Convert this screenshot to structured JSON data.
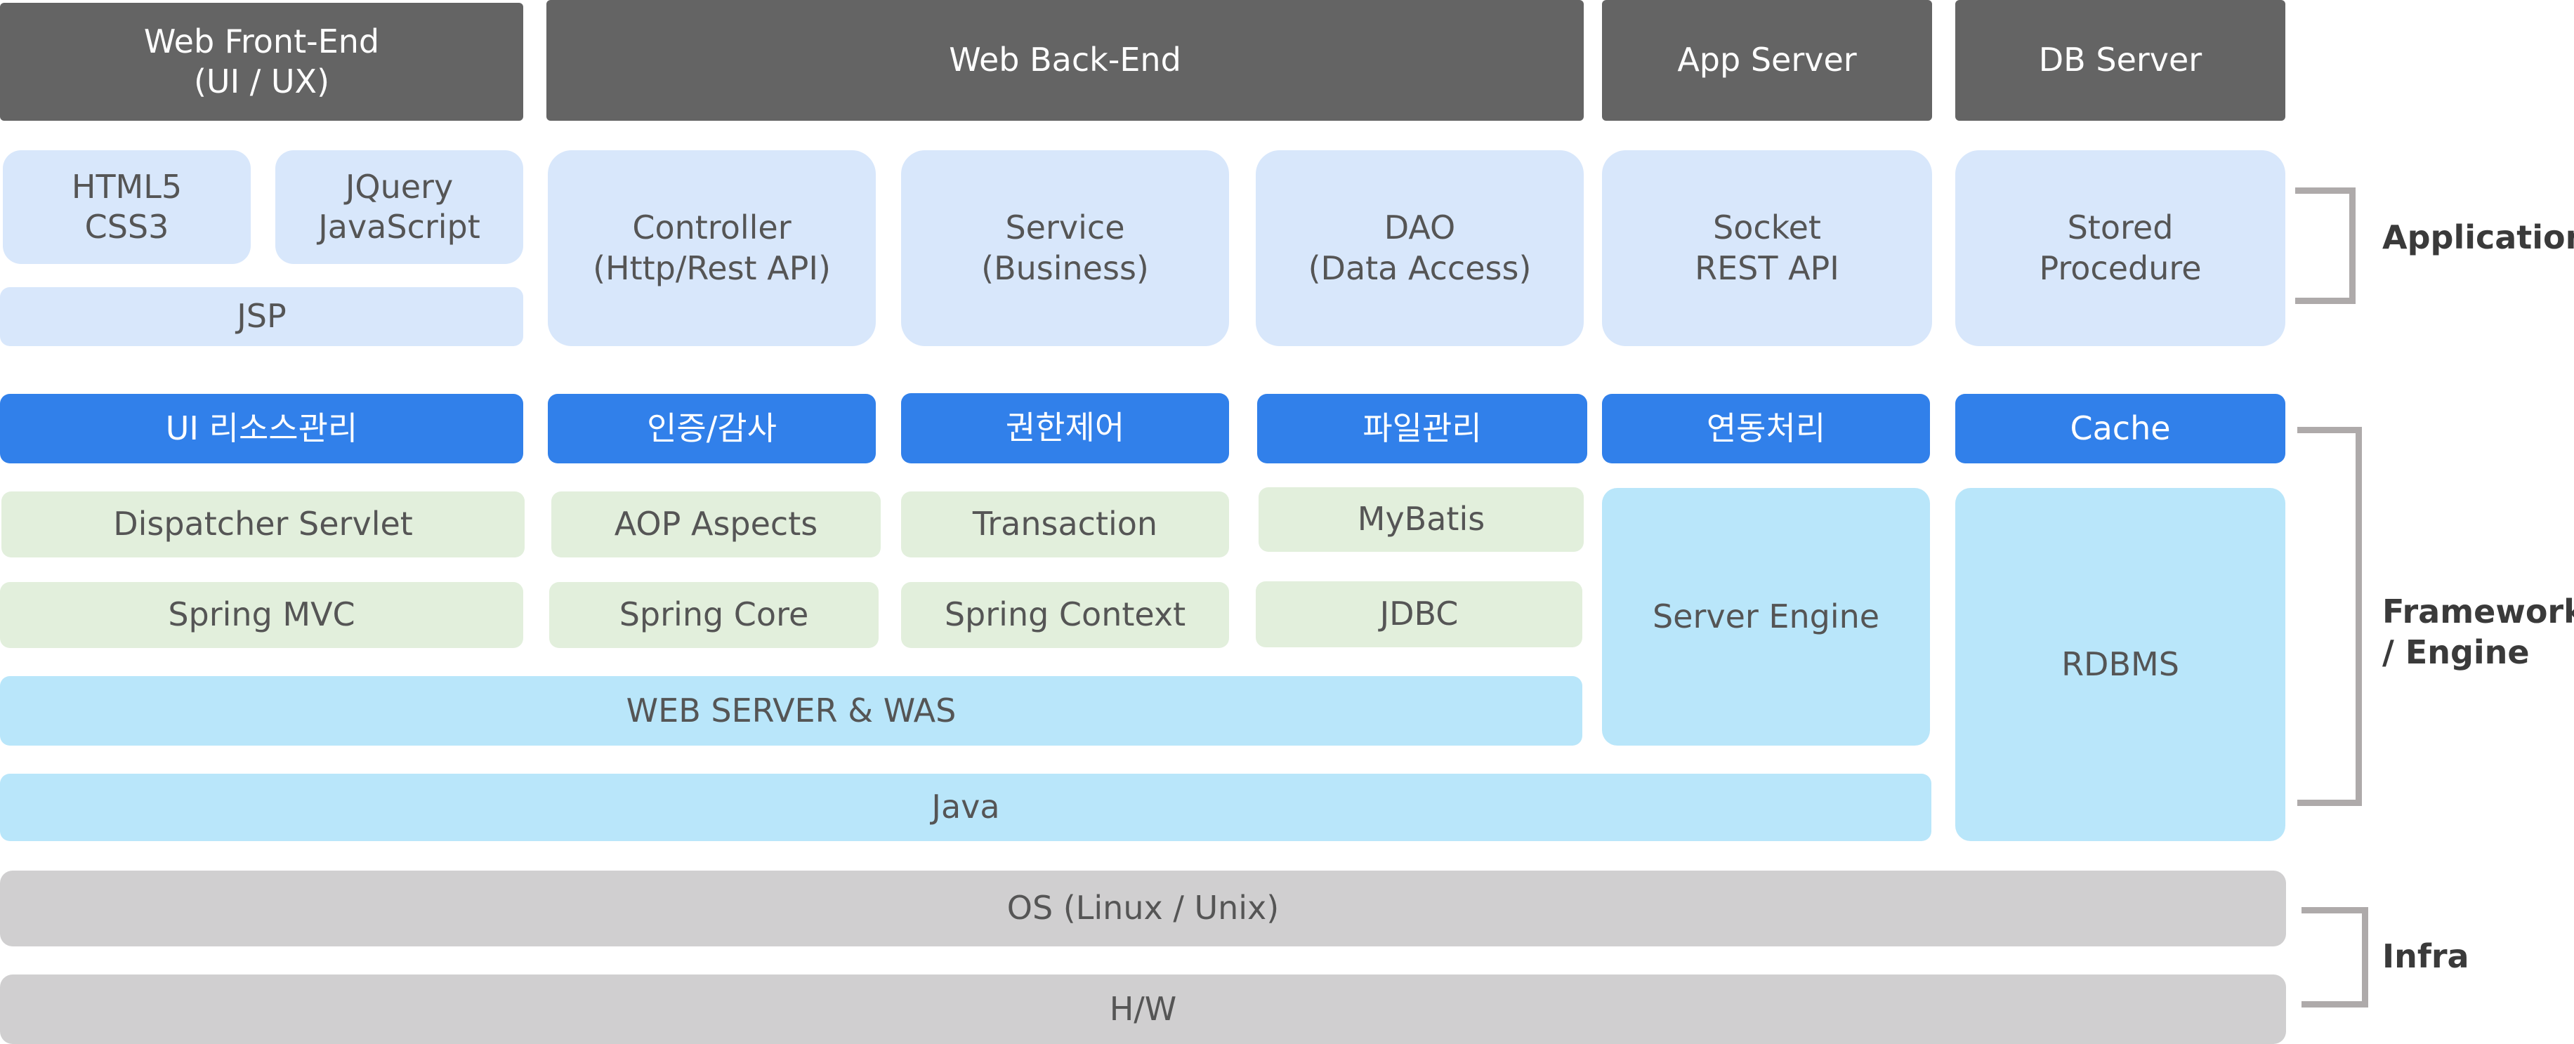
{
  "headers": {
    "front_end": "Web Front-End\n(UI / UX)",
    "back_end": "Web Back-End",
    "app_server": "App Server",
    "db_server": "DB Server"
  },
  "application": {
    "html5": "HTML5\nCSS3",
    "jquery": "JQuery\nJavaScript",
    "jsp": "JSP",
    "controller": "Controller\n(Http/Rest API)",
    "service": "Service\n(Business)",
    "dao": "DAO\n(Data Access)",
    "socket": "Socket\nREST API",
    "stored_procedure": "Stored\nProcedure"
  },
  "modules": {
    "ui_resource": "UI 리소스관리",
    "auth_audit": "인증/감사",
    "permission": "권한제어",
    "file_mgmt": "파일관리",
    "integration": "연동처리",
    "cache": "Cache"
  },
  "framework": {
    "dispatcher_servlet": "Dispatcher Servlet",
    "aop_aspects": "AOP Aspects",
    "transaction": "Transaction",
    "mybatis": "MyBatis",
    "spring_mvc": "Spring MVC",
    "spring_core": "Spring Core",
    "spring_context": "Spring Context",
    "jdbc": "JDBC",
    "web_server_was": "WEB SERVER & WAS",
    "server_engine": "Server Engine",
    "rdbms": "RDBMS",
    "java": "Java"
  },
  "infra": {
    "os": "OS (Linux / Unix)",
    "hw": "H/W"
  },
  "layers": {
    "application": "Application",
    "framework_engine": "Framework\n/ Engine",
    "infra": "Infra"
  },
  "colors": {
    "header": "#646464",
    "application": "#d8e7fb",
    "module": "#3180ea",
    "framework": "#e2efdc",
    "engine": "#b9e6fa",
    "infra": "#d0cfd0",
    "bracket": "#aeaaaa"
  }
}
